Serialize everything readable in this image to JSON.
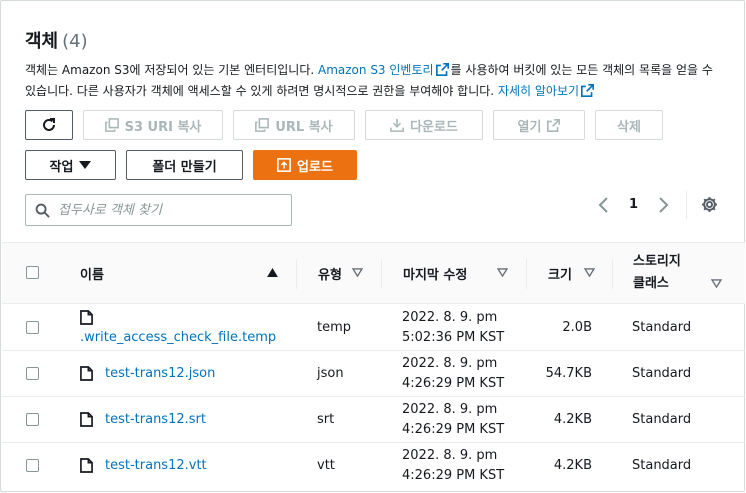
{
  "header": {
    "title": "객체",
    "count": "(4)",
    "desc_part1": "객체는 Amazon S3에 저장되어 있는 기본 엔터티입니다. ",
    "desc_link1": "Amazon S3 인벤토리",
    "desc_part2": "를 사용하여 버킷에 있는 모든 객체의 목록을 얻을 수 있습니다. 다른 사용자가 객체에 액세스할 수 있게 하려면 명시적으로 권한을 부여해야 합니다. ",
    "desc_link2": "자세히 알아보기"
  },
  "toolbar": {
    "copy_s3_uri": "S3 URI 복사",
    "copy_url": "URL 복사",
    "download": "다운로드",
    "open": "열기",
    "delete": "삭제",
    "actions": "작업",
    "create_folder": "폴더 만들기",
    "upload": "업로드"
  },
  "search": {
    "placeholder": "접두사로 객체 찾기"
  },
  "pagination": {
    "current_page": "1"
  },
  "table": {
    "columns": {
      "name": "이름",
      "type": "유형",
      "modified": "마지막 수정",
      "size": "크기",
      "storage_class_line1": "스토리지",
      "storage_class_line2": "클래스"
    },
    "rows": [
      {
        "name": ".write_access_check_file.temp",
        "type": "temp",
        "modified_date": "2022. 8. 9. pm",
        "modified_time": "5:02:36 PM KST",
        "size": "2.0B",
        "storage_class": "Standard"
      },
      {
        "name": "test-trans12.json",
        "type": "json",
        "modified_date": "2022. 8. 9. pm",
        "modified_time": "4:26:29 PM KST",
        "size": "54.7KB",
        "storage_class": "Standard"
      },
      {
        "name": "test-trans12.srt",
        "type": "srt",
        "modified_date": "2022. 8. 9. pm",
        "modified_time": "4:26:29 PM KST",
        "size": "4.2KB",
        "storage_class": "Standard"
      },
      {
        "name": "test-trans12.vtt",
        "type": "vtt",
        "modified_date": "2022. 8. 9. pm",
        "modified_time": "4:26:29 PM KST",
        "size": "4.2KB",
        "storage_class": "Standard"
      }
    ]
  },
  "colors": {
    "link": "#0073bb",
    "primary": "#ec7211",
    "disabled": "#aab7b8",
    "border": "#545b64"
  },
  "icons": [
    "refresh-icon",
    "copy-icon",
    "download-icon",
    "external-link-icon",
    "caret-down-icon",
    "upload-icon",
    "search-icon",
    "chevron-left-icon",
    "chevron-right-icon",
    "gear-icon",
    "file-icon",
    "sort-up-icon",
    "sort-down-icon"
  ]
}
